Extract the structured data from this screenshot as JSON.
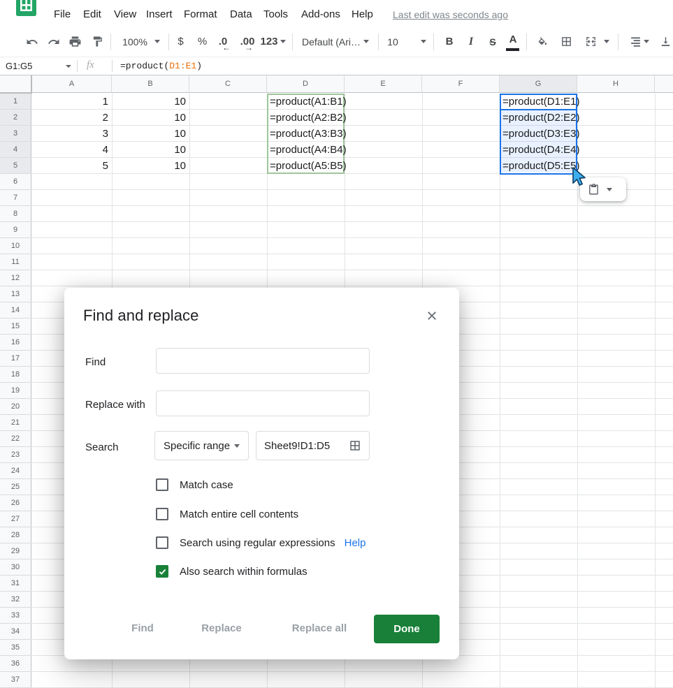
{
  "topbar": {
    "menus": [
      "File",
      "Edit",
      "View",
      "Insert",
      "Format",
      "Data",
      "Tools",
      "Add-ons",
      "Help"
    ],
    "last_edit": "Last edit was seconds ago"
  },
  "toolbar": {
    "zoom": "100%",
    "currency": "$",
    "percent": "%",
    "decrease_decimal": ".0",
    "increase_decimal": ".00",
    "more_formats": "123",
    "font_name": "Default (Ari…",
    "font_size": "10",
    "bold": "B",
    "italic": "I",
    "strikethrough": "S",
    "text_color": "A"
  },
  "formula_bar": {
    "name_box": "G1:G5",
    "fx": "fx",
    "formula_prefix": "=product(",
    "formula_range": "D1:E1",
    "formula_suffix": ")"
  },
  "grid": {
    "column_letters": [
      "A",
      "B",
      "C",
      "D",
      "E",
      "F",
      "G",
      "H"
    ],
    "row_count": 37,
    "selected_rows": [
      1,
      2,
      3,
      4,
      5
    ],
    "selected_columns": [
      "G"
    ],
    "cells": {
      "A": [
        "1",
        "2",
        "3",
        "4",
        "5"
      ],
      "B": [
        "10",
        "10",
        "10",
        "10",
        "10"
      ],
      "D": [
        "=product(A1:B1)",
        "=product(A2:B2)",
        "=product(A3:B3)",
        "=product(A4:B4)",
        "=product(A5:B5)"
      ],
      "G": [
        "=product(D1:E1)",
        "=product(D2:E2)",
        "=product(D3:E3)",
        "=product(D4:E4)",
        "=product(D5:E5)"
      ]
    },
    "highlight_range": "D1:D5",
    "selection_range": "G1:G5"
  },
  "dialog": {
    "title": "Find and replace",
    "find_label": "Find",
    "find_value": "",
    "replace_label": "Replace with",
    "replace_value": "",
    "search_label": "Search",
    "search_value": "Specific range",
    "range_value": "Sheet9!D1:D5",
    "checkboxes": [
      {
        "label": "Match case",
        "checked": false
      },
      {
        "label": "Match entire cell contents",
        "checked": false
      },
      {
        "label": "Search using regular expressions",
        "checked": false,
        "link": "Help"
      },
      {
        "label": "Also search within formulas",
        "checked": true
      }
    ],
    "buttons": {
      "find": "Find",
      "replace": "Replace",
      "replace_all": "Replace all",
      "done": "Done"
    }
  },
  "colors": {
    "accent_green": "#188038",
    "selection_blue": "#1a73e8",
    "range_green": "#9fc69c",
    "formula_range_orange": "#e8710a",
    "logo_green": "#23a566",
    "link_blue": "#1a73e8"
  }
}
